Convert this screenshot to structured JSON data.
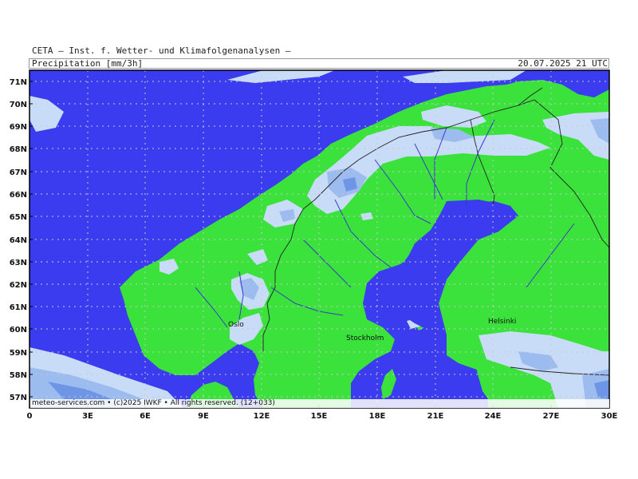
{
  "header": {
    "organization": "CETA — Inst. f. Wetter- und Klimafolgenanalysen —",
    "product": "Precipitation [mm/3h]",
    "valid_time": "20.07.2025 21 UTC"
  },
  "footer": {
    "credit": "meteo-services.com • (c)2025 IWKF • All rights reserved. (12+033)"
  },
  "axes": {
    "lat_labels": [
      "71N",
      "70N",
      "69N",
      "68N",
      "67N",
      "66N",
      "65N",
      "64N",
      "63N",
      "62N",
      "61N",
      "60N",
      "59N",
      "58N",
      "57N"
    ],
    "lon_labels": [
      "0",
      "3E",
      "6E",
      "9E",
      "12E",
      "15E",
      "18E",
      "21E",
      "24E",
      "27E",
      "30E"
    ]
  },
  "cities": [
    {
      "name": "Oslo"
    },
    {
      "name": "Stockholm"
    },
    {
      "name": "Helsinki"
    }
  ],
  "colors": {
    "sea": "#3b3bef",
    "land": "#3ce23c",
    "precip_light": "#c8dcf8",
    "precip_medium": "#9cbcf0",
    "precip_heavy": "#6f96e6",
    "border": "#222222",
    "river": "#3a3ac8",
    "grid": "#c8c8c8"
  }
}
